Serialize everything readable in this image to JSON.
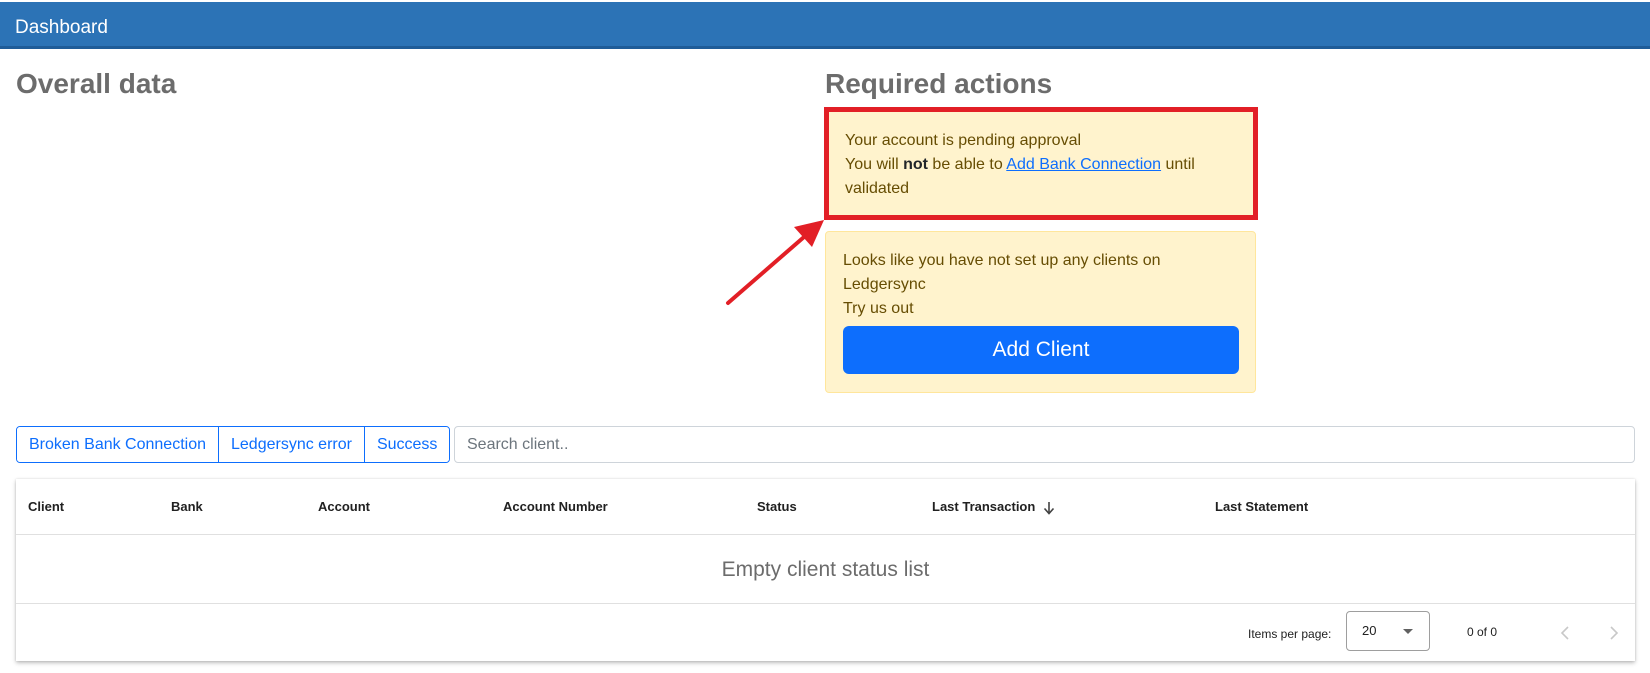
{
  "header": {
    "title": "Dashboard"
  },
  "sections": {
    "overall_title": "Overall data",
    "required_title": "Required actions"
  },
  "pending_alert": {
    "line1": "Your account is pending approval",
    "line2_prefix": "You will ",
    "line2_bold": "not",
    "line2_middle": " be able to ",
    "link_text": "Add Bank Connection",
    "line2_suffix": " until validated"
  },
  "clients_alert": {
    "line1": "Looks like you have not set up any clients on Ledgersync",
    "line2": "Try us out",
    "button_label": "Add Client"
  },
  "filters": [
    {
      "label": "Broken Bank Connection"
    },
    {
      "label": "Ledgersync error"
    },
    {
      "label": "Success"
    }
  ],
  "search": {
    "placeholder": "Search client..",
    "value": ""
  },
  "table": {
    "columns": [
      {
        "label": "Client"
      },
      {
        "label": "Bank"
      },
      {
        "label": "Account"
      },
      {
        "label": "Account Number"
      },
      {
        "label": "Status"
      },
      {
        "label": "Last Transaction"
      },
      {
        "label": "Last Statement"
      }
    ],
    "sorted_column": "Last Transaction",
    "empty_message": "Empty client status list"
  },
  "paginator": {
    "items_per_page_label": "Items per page:",
    "page_size": "20",
    "range_label": "0 of 0"
  },
  "colors": {
    "header_bg": "#2c73b6",
    "primary": "#0d6efd",
    "warning_bg": "#fff3cd",
    "highlight": "#e21f26"
  }
}
